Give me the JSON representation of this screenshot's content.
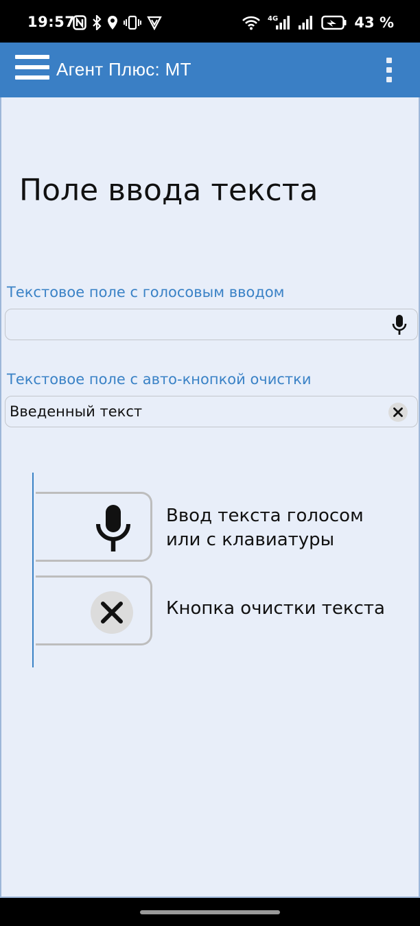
{
  "status_bar": {
    "time": "19:57",
    "battery_percent": "43 %",
    "network_label": "4G",
    "left_icons": [
      "nfc-icon",
      "bluetooth-icon",
      "location-icon",
      "vibrate-icon",
      "vpn-shield-icon"
    ],
    "right_icons": [
      "wifi-icon",
      "signal-4g-icon",
      "signal-icon",
      "battery-charging-icon"
    ]
  },
  "app_bar": {
    "title": "Агент Плюс: МТ",
    "menu_icon": "hamburger-menu-icon",
    "overflow_icon": "more-vert-icon",
    "color": "#3a7fc5"
  },
  "page": {
    "title": "Поле ввода текста",
    "background": "#e8eef9"
  },
  "fields": {
    "voice": {
      "label": "Текстовое поле с голосовым вводом",
      "value": "",
      "icon": "microphone-icon"
    },
    "clear": {
      "label": "Текстовое поле с авто-кнопкой очистки",
      "value": "Введенный текст",
      "icon": "clear-icon"
    }
  },
  "legend": {
    "items": [
      {
        "icon": "microphone-icon",
        "line1": "Ввод текста голосом",
        "line2": "или с клавиатуры"
      },
      {
        "icon": "clear-icon",
        "line1": "Кнопка очистки текста"
      }
    ],
    "accent": "#3a82c6"
  }
}
